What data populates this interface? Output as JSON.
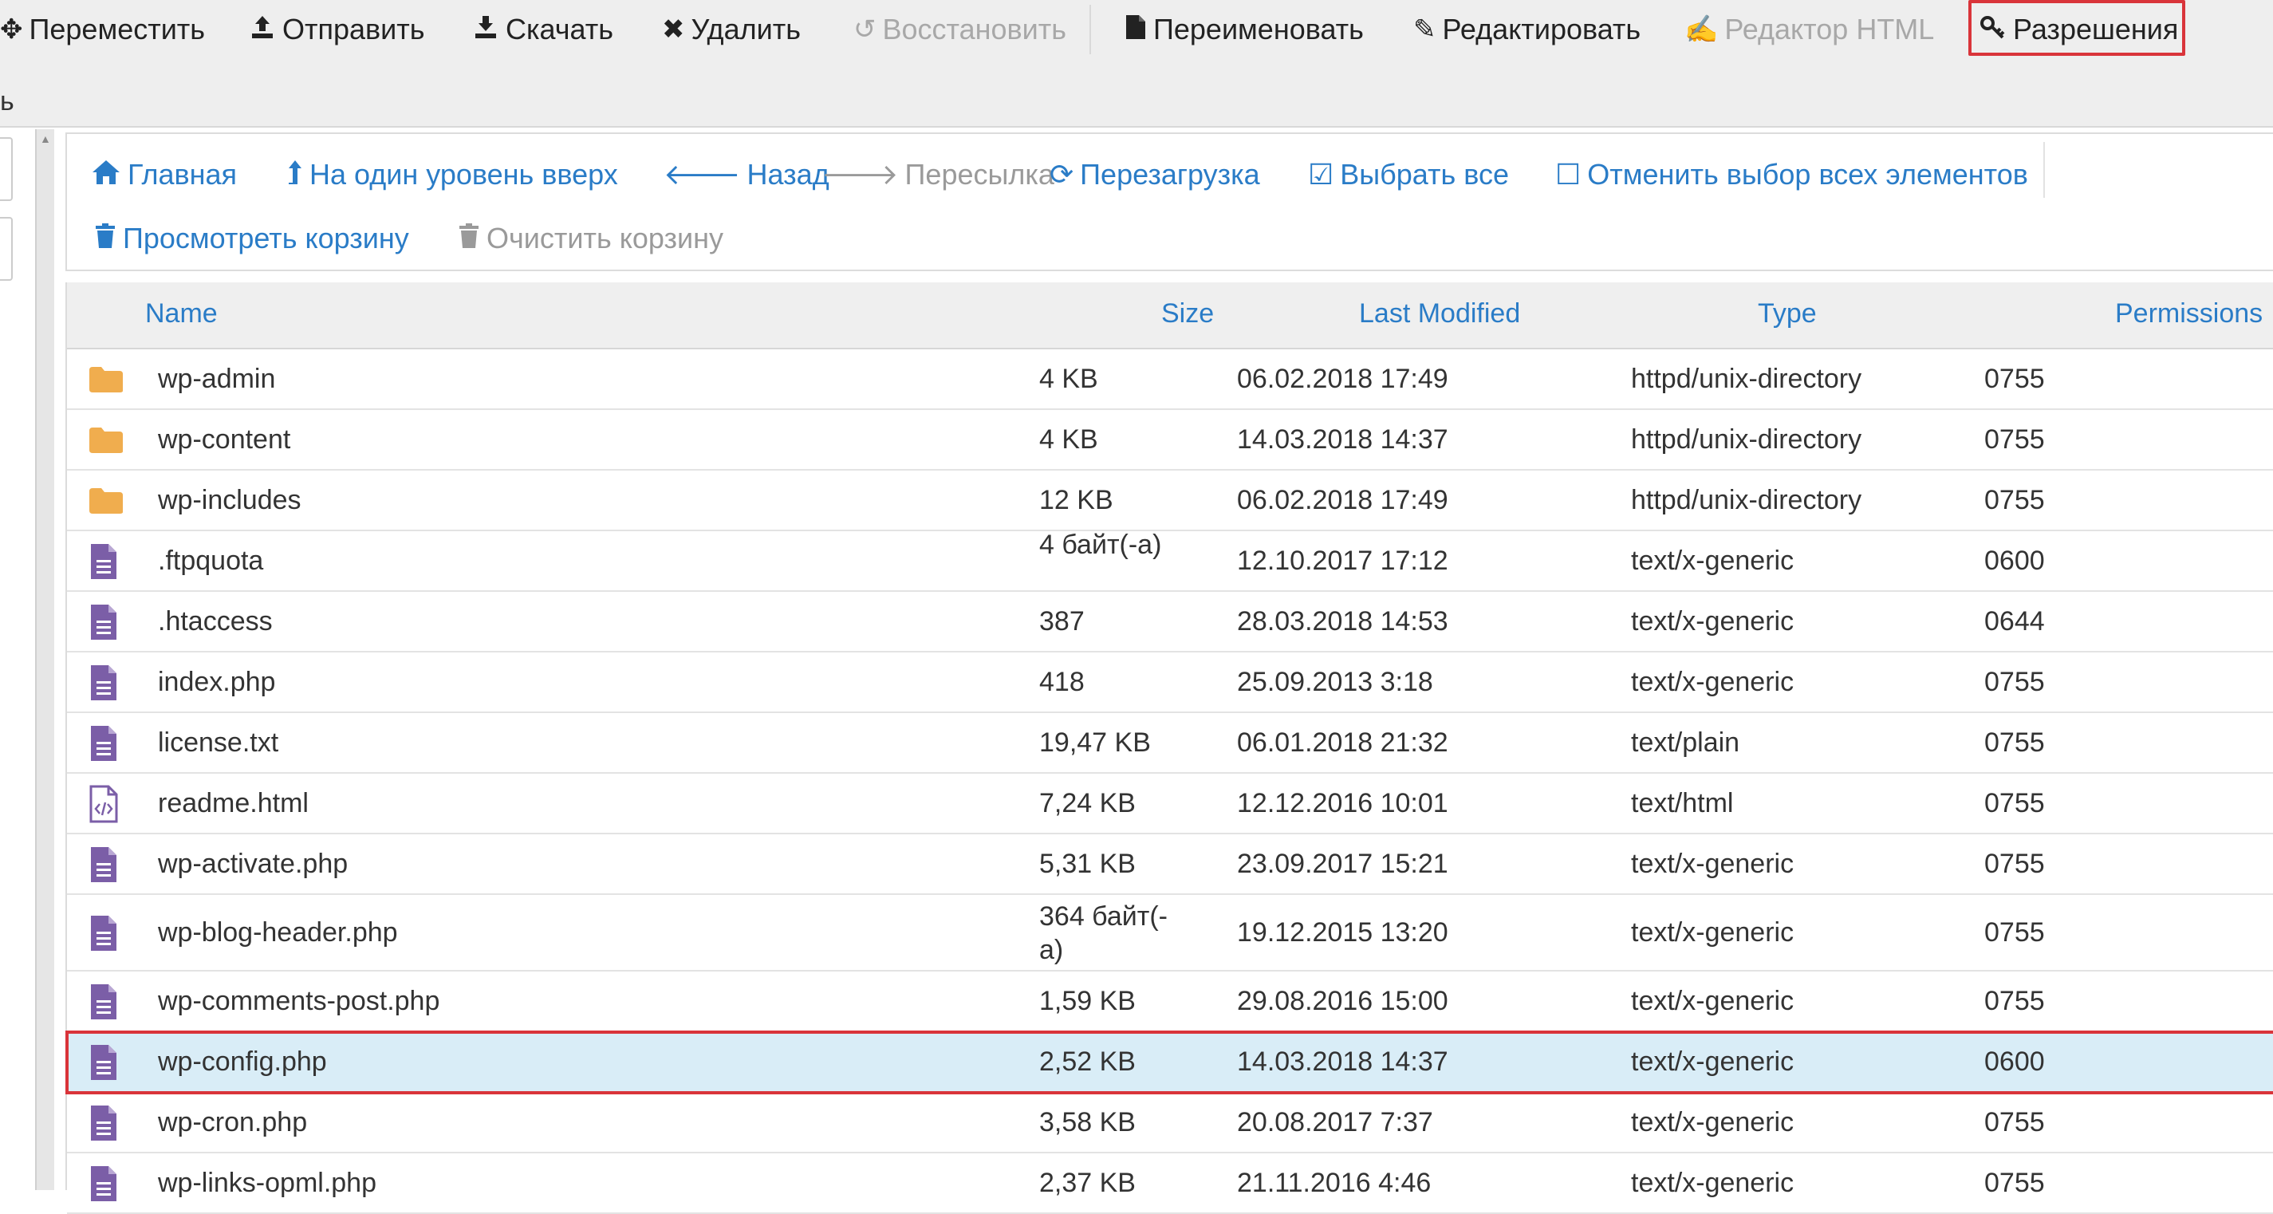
{
  "toolbar": {
    "items": [
      {
        "label": "Переместить",
        "icon": "arrows-move-icon",
        "enabled": true
      },
      {
        "label": "Отправить",
        "icon": "upload-icon",
        "enabled": true
      },
      {
        "label": "Скачать",
        "icon": "download-icon",
        "enabled": true
      },
      {
        "label": "Удалить",
        "icon": "close-icon",
        "enabled": true
      },
      {
        "label": "Восстановить",
        "icon": "undo-icon",
        "enabled": false
      },
      {
        "label": "Переименовать",
        "icon": "file-icon",
        "enabled": true
      },
      {
        "label": "Редактировать",
        "icon": "pencil-icon",
        "enabled": true
      },
      {
        "label": "Редактор HTML",
        "icon": "edit-square-icon",
        "enabled": false
      },
      {
        "label": "Разрешения",
        "icon": "key-icon",
        "enabled": true,
        "highlighted": true
      }
    ],
    "stub": "ь"
  },
  "nav": {
    "items": [
      {
        "label": "Главная",
        "icon": "home-icon",
        "enabled": true
      },
      {
        "label": "На один уровень вверх",
        "icon": "level-up-icon",
        "enabled": true
      },
      {
        "label": "Назад",
        "icon": "arrow-left-icon",
        "enabled": true
      },
      {
        "label": "Пересылка",
        "icon": "arrow-right-icon",
        "enabled": false
      },
      {
        "label": "Перезагрузка",
        "icon": "refresh-icon",
        "enabled": true
      },
      {
        "label": "Выбрать все",
        "icon": "check-square-icon",
        "enabled": true
      },
      {
        "label": "Отменить выбор всех элементов",
        "icon": "square-icon",
        "enabled": true
      },
      {
        "label": "Просмотреть корзину",
        "icon": "trash-icon",
        "enabled": true
      },
      {
        "label": "Очистить корзину",
        "icon": "trash-icon",
        "enabled": false
      }
    ]
  },
  "table": {
    "headers": {
      "name": "Name",
      "size": "Size",
      "modified": "Last Modified",
      "type": "Type",
      "perms": "Permissions"
    },
    "rows": [
      {
        "name": "wp-admin",
        "size": "4 KB",
        "modified": "06.02.2018 17:49",
        "type": "httpd/unix-directory",
        "perms": "0755",
        "icon": "folder-icon"
      },
      {
        "name": "wp-content",
        "size": "4 KB",
        "modified": "14.03.2018 14:37",
        "type": "httpd/unix-directory",
        "perms": "0755",
        "icon": "folder-icon"
      },
      {
        "name": "wp-includes",
        "size": "12 KB",
        "modified": "06.02.2018 17:49",
        "type": "httpd/unix-directory",
        "perms": "0755",
        "icon": "folder-icon"
      },
      {
        "name": ".ftpquota",
        "size": "4 байт(-а)",
        "modified": "12.10.2017 17:12",
        "type": "text/x-generic",
        "perms": "0600",
        "icon": "text-file-icon"
      },
      {
        "name": ".htaccess",
        "size": "387",
        "modified": "28.03.2018 14:53",
        "type": "text/x-generic",
        "perms": "0644",
        "icon": "text-file-icon"
      },
      {
        "name": "index.php",
        "size": "418",
        "modified": "25.09.2013 3:18",
        "type": "text/x-generic",
        "perms": "0755",
        "icon": "text-file-icon"
      },
      {
        "name": "license.txt",
        "size": "19,47 KB",
        "modified": "06.01.2018 21:32",
        "type": "text/plain",
        "perms": "0755",
        "icon": "text-file-icon"
      },
      {
        "name": "readme.html",
        "size": "7,24 KB",
        "modified": "12.12.2016 10:01",
        "type": "text/html",
        "perms": "0755",
        "icon": "code-file-icon"
      },
      {
        "name": "wp-activate.php",
        "size": "5,31 KB",
        "modified": "23.09.2017 15:21",
        "type": "text/x-generic",
        "perms": "0755",
        "icon": "text-file-icon"
      },
      {
        "name": "wp-blog-header.php",
        "size": "364 байт(-а)",
        "modified": "19.12.2015 13:20",
        "type": "text/x-generic",
        "perms": "0755",
        "icon": "text-file-icon"
      },
      {
        "name": "wp-comments-post.php",
        "size": "1,59 KB",
        "modified": "29.08.2016 15:00",
        "type": "text/x-generic",
        "perms": "0755",
        "icon": "text-file-icon"
      },
      {
        "name": "wp-config.php",
        "size": "2,52 KB",
        "modified": "14.03.2018 14:37",
        "type": "text/x-generic",
        "perms": "0600",
        "icon": "text-file-icon",
        "selected": true
      },
      {
        "name": "wp-cron.php",
        "size": "3,58 KB",
        "modified": "20.08.2017 7:37",
        "type": "text/x-generic",
        "perms": "0755",
        "icon": "text-file-icon"
      },
      {
        "name": "wp-links-opml.php",
        "size": "2,37 KB",
        "modified": "21.11.2016 4:46",
        "type": "text/x-generic",
        "perms": "0755",
        "icon": "text-file-icon"
      }
    ]
  },
  "colors": {
    "link": "#2a7cc7",
    "folder": "#f0ad4e",
    "file": "#7b5ea7",
    "highlight": "#d9343a",
    "selected_row": "#d9edf7"
  }
}
